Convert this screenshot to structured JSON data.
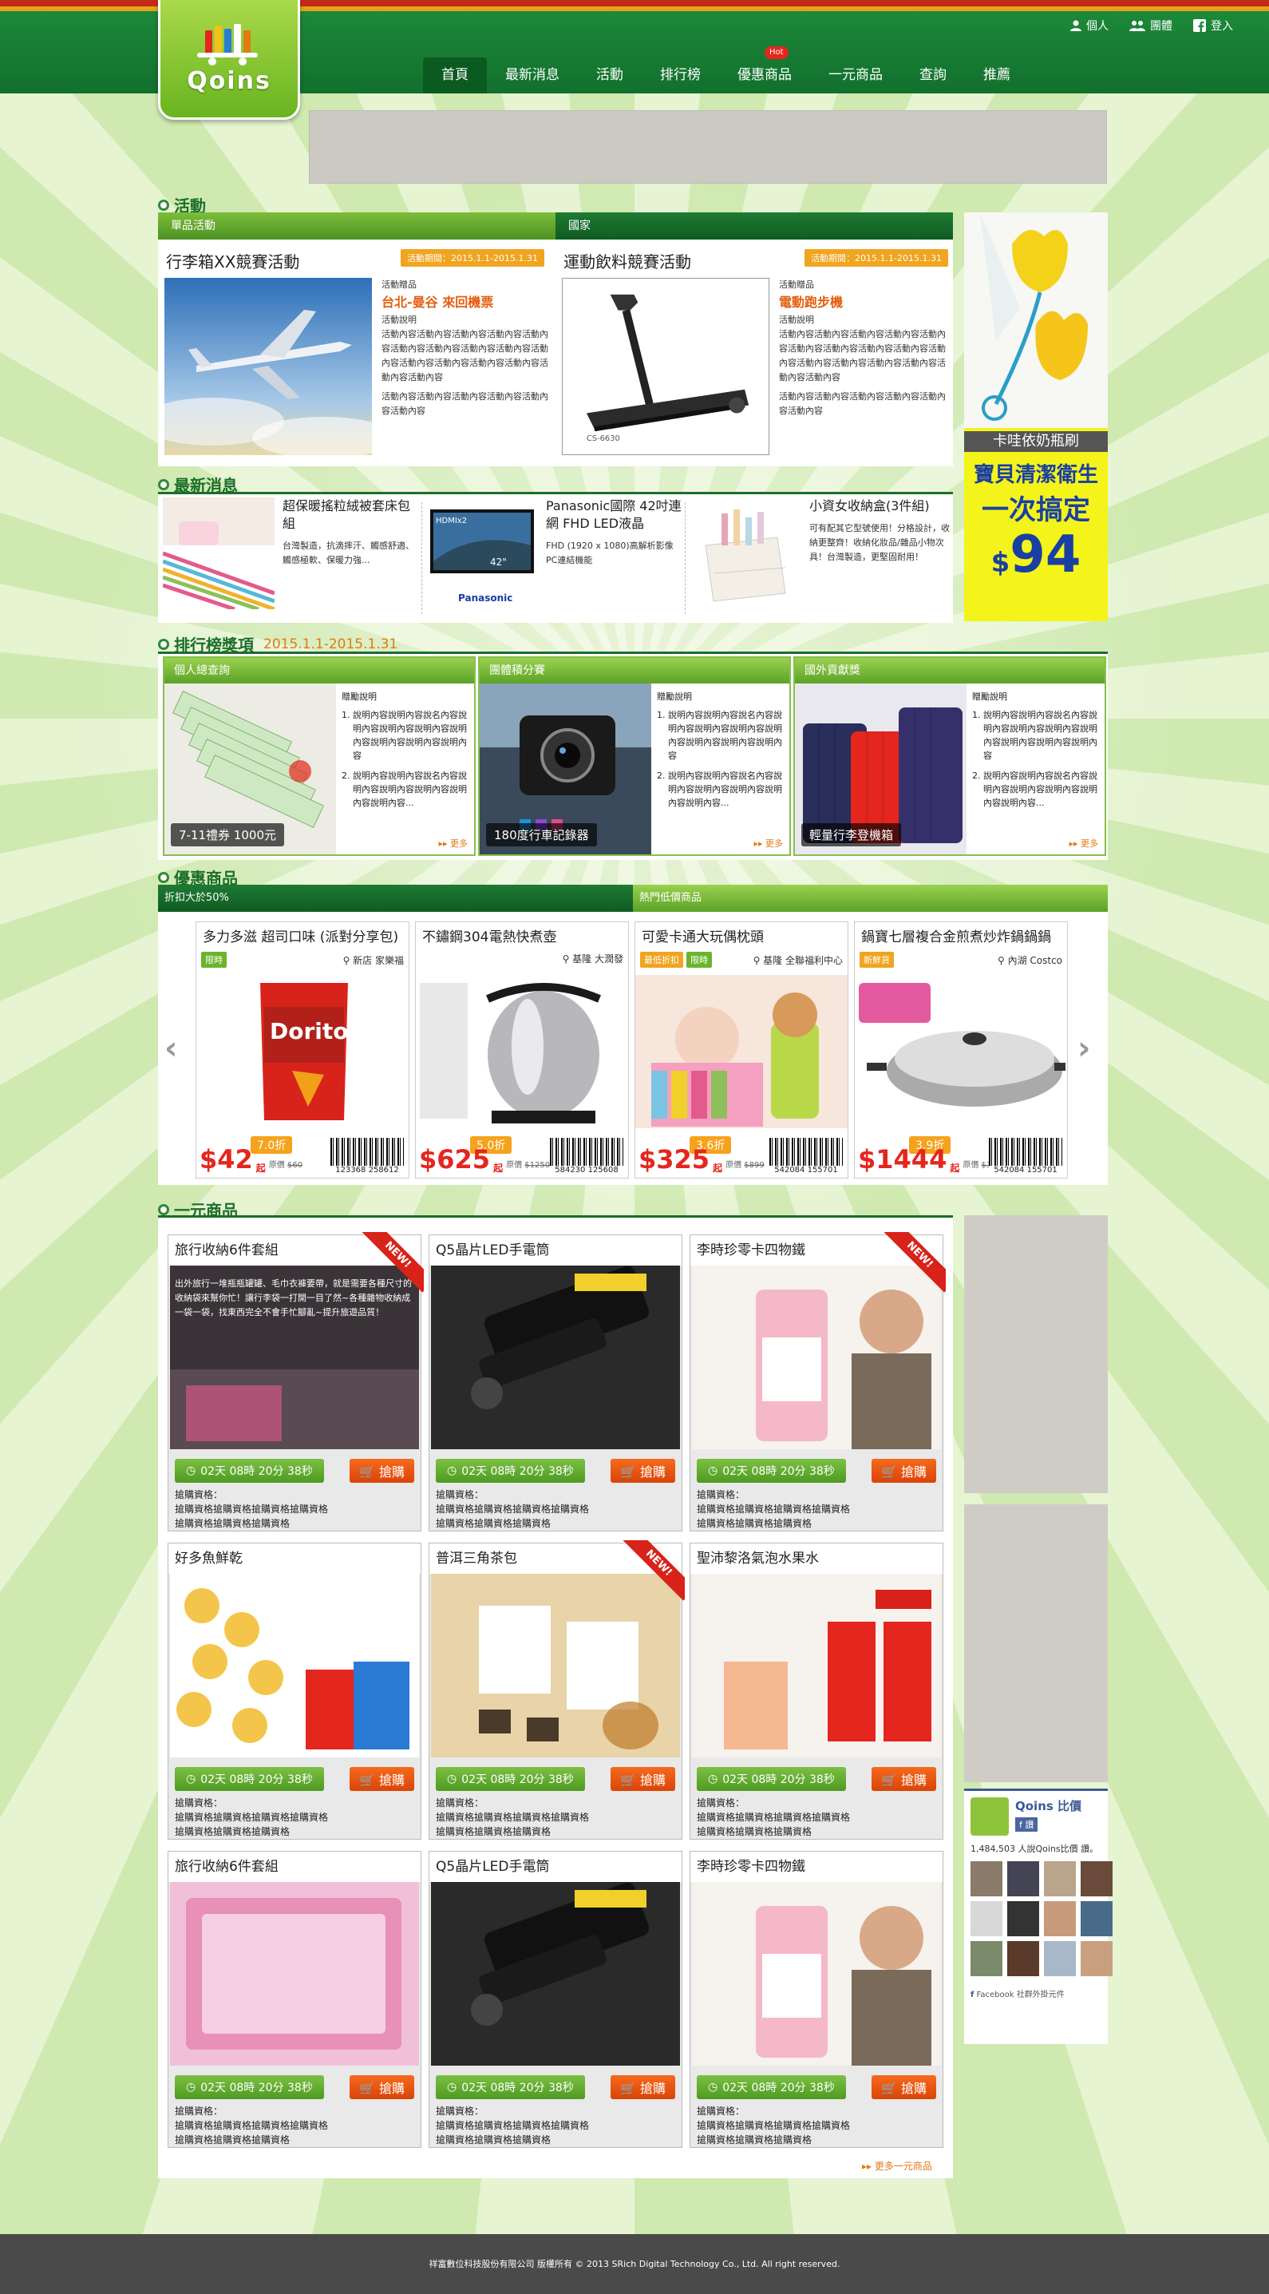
{
  "nav": {
    "toplinks": [
      "個人",
      "團體",
      "登入"
    ],
    "items": [
      "首頁",
      "最新消息",
      "活動",
      "排行榜",
      "優惠商品",
      "一元商品",
      "查詢",
      "推薦"
    ],
    "hot_badge": "Hot",
    "logo_text": "Qoins"
  },
  "activity": {
    "section_title": "活動",
    "tab_left": "單品活動",
    "tab_right": "國家",
    "cards": [
      {
        "title": "行李箱XX競賽活動",
        "period": "活動期間：2015.1.1-2015.1.31",
        "prize_label": "活動贈品",
        "prize": "台北-曼谷 來回機票",
        "desc_label": "活動說明",
        "desc": "活動內容活動內容活動內容活動內容活動內容活動內容活動內容活動內容活動內容活動內容活動內容活動內容活動內容活動內容活動內容活動內容",
        "desc2": "活動內容活動內容活動內容活動內容活動內容活動內容"
      },
      {
        "title": "運動飲料競賽活動",
        "period": "活動期間：2015.1.1-2015.1.31",
        "prize_label": "活動贈品",
        "prize": "電動跑步機",
        "desc_label": "活動說明",
        "desc": "活動內容活動內容活動內容活動內容活動內容活動內容活動內容活動內容活動內容活動內容活動內容活動內容活動內容活動內容活動內容活動內容",
        "desc2": "活動內容活動內容活動內容活動內容活動內容活動內容"
      }
    ]
  },
  "news": {
    "section_title": "最新消息",
    "items": [
      {
        "title": "超保暖搖粒絨被套床包組",
        "desc": "台灣製造，抗滴摔汗、觸感舒適、觸感極軟、保暖力強..."
      },
      {
        "title": "Panasonic國際 42吋連網 FHD LED液晶",
        "desc": "FHD (1920 x 1080)高解析影像 PC連結機能"
      },
      {
        "title": "小資女收納盒(3件組)",
        "desc": "可有配其它型號使用！分格設計，收納更整齊！收納化妝品/雜品小物次具！台灣製造，更堅固耐用！"
      }
    ]
  },
  "ranking": {
    "section_title": "排行榜獎項",
    "period": "2015.1.1-2015.1.31",
    "more": "更多",
    "cards": [
      {
        "header": "個人總查詢",
        "caption": "7-11禮券 1000元",
        "label": "贈勵說明",
        "items": [
          "說明內容說明內容說名內容說明內容說明內容說明內容說明內容說明內容說明內容說明內容",
          "說明內容說明內容說名內容說明內容說明內容說明內容說明內容說明內容..."
        ]
      },
      {
        "header": "團體積分賽",
        "caption": "180度行車記錄器",
        "label": "贈勵說明",
        "items": [
          "說明內容說明內容說名內容說明內容說明內容說明內容說明內容說明內容說明內容說明內容",
          "說明內容說明內容說名內容說明內容說明內容說明內容說明內容說明內容..."
        ]
      },
      {
        "header": "國外貢獻獎",
        "caption": "輕量行李登機箱",
        "label": "贈勵說明",
        "items": [
          "說明內容說明內容說名內容說明內容說明內容說明內容說明內容說明內容說明內容說明內容",
          "說明內容說明內容說名內容說明內容說明內容說明內容說明內容說明內容..."
        ]
      }
    ]
  },
  "deals": {
    "section_title": "優惠商品",
    "tab_left": "折扣大於50%",
    "tab_right": "熱門低價商品",
    "items": [
      {
        "title": "多力多滋 超司口味 (派對分享包)",
        "tags": [
          "限時"
        ],
        "location": "新店 家樂福",
        "price": "$42",
        "unit": "起",
        "orig_label": "原價",
        "orig": "$60",
        "discount": "7.0折",
        "barcode": "123368  258612"
      },
      {
        "title": "不鏽鋼304電熱快煮壺",
        "tags": [],
        "location": "基隆 大潤發",
        "price": "$625",
        "unit": "起",
        "orig_label": "原價",
        "orig": "$1250",
        "discount": "5.0折",
        "barcode": "584230  125608"
      },
      {
        "title": "可愛卡通大玩偶枕頭",
        "tags": [
          "最低折扣",
          "限時"
        ],
        "location": "基隆 全聯福利中心",
        "price": "$325",
        "unit": "起",
        "orig_label": "原價",
        "orig": "$899",
        "discount": "3.6折",
        "barcode": "542084  155701"
      },
      {
        "title": "鍋寶七層複合金煎煮炒炸鍋鍋鍋",
        "tags": [
          "新鮮貨"
        ],
        "location": "內湖 Costco",
        "price": "$1444",
        "unit": "起",
        "orig_label": "原價",
        "orig": "$3600",
        "discount": "3.9折",
        "barcode": "542084  155701"
      }
    ]
  },
  "onedollar": {
    "section_title": "一元商品",
    "timer": "02天 08時 20分 38秒",
    "buy": "搶購",
    "desc_lines": [
      "搶購資格：",
      "搶購資格搶購資格搶購資格搶購資格",
      "搶購資格搶購資格搶購資格"
    ],
    "more": "更多一元商品",
    "new_label": "NEW!",
    "items": [
      {
        "title": "旅行收納6件套組",
        "new": true,
        "overlay": "出外旅行一堆瓶瓶罐罐、毛巾衣褲要帶，就是需要各種尺寸的收納袋來幫你忙！讓行李袋一打開一目了然~各種雜物收納成一袋一袋，找東西完全不會手忙腳亂~提升旅遊品質！"
      },
      {
        "title": "Q5晶片LED手電筒",
        "new": false
      },
      {
        "title": "李時珍零卡四物鐵",
        "new": true
      },
      {
        "title": "好多魚鮮乾",
        "new": false
      },
      {
        "title": "普洱三角茶包",
        "new": true
      },
      {
        "title": "聖沛黎洛氣泡水果水",
        "new": false
      },
      {
        "title": "旅行收納6件套組",
        "new": false
      },
      {
        "title": "Q5晶片LED手電筒",
        "new": false
      },
      {
        "title": "李時珍零卡四物鐵",
        "new": false
      }
    ]
  },
  "sidebar": {
    "ad_brand": "卡哇依奶瓶刷",
    "ad_line1": "寶貝清潔衛生",
    "ad_line2": "一次搞定",
    "ad_price": "94",
    "fb_title": "Qoins 比價",
    "fb_like": "讚",
    "fb_count": "1,484,503 人說Qoins比價 讚。",
    "fb_footer": "Facebook 社群外掛元件"
  },
  "footer": {
    "text": "祥富數位科技股份有限公司 版權所有 © 2013 SRich Digital Technology Co., Ltd. All right reserved."
  },
  "colors": {
    "brand_green": "#1d8a3a",
    "accent_orange": "#e07b12",
    "buy_orange": "#e8541a",
    "price_red": "#e5261e"
  }
}
